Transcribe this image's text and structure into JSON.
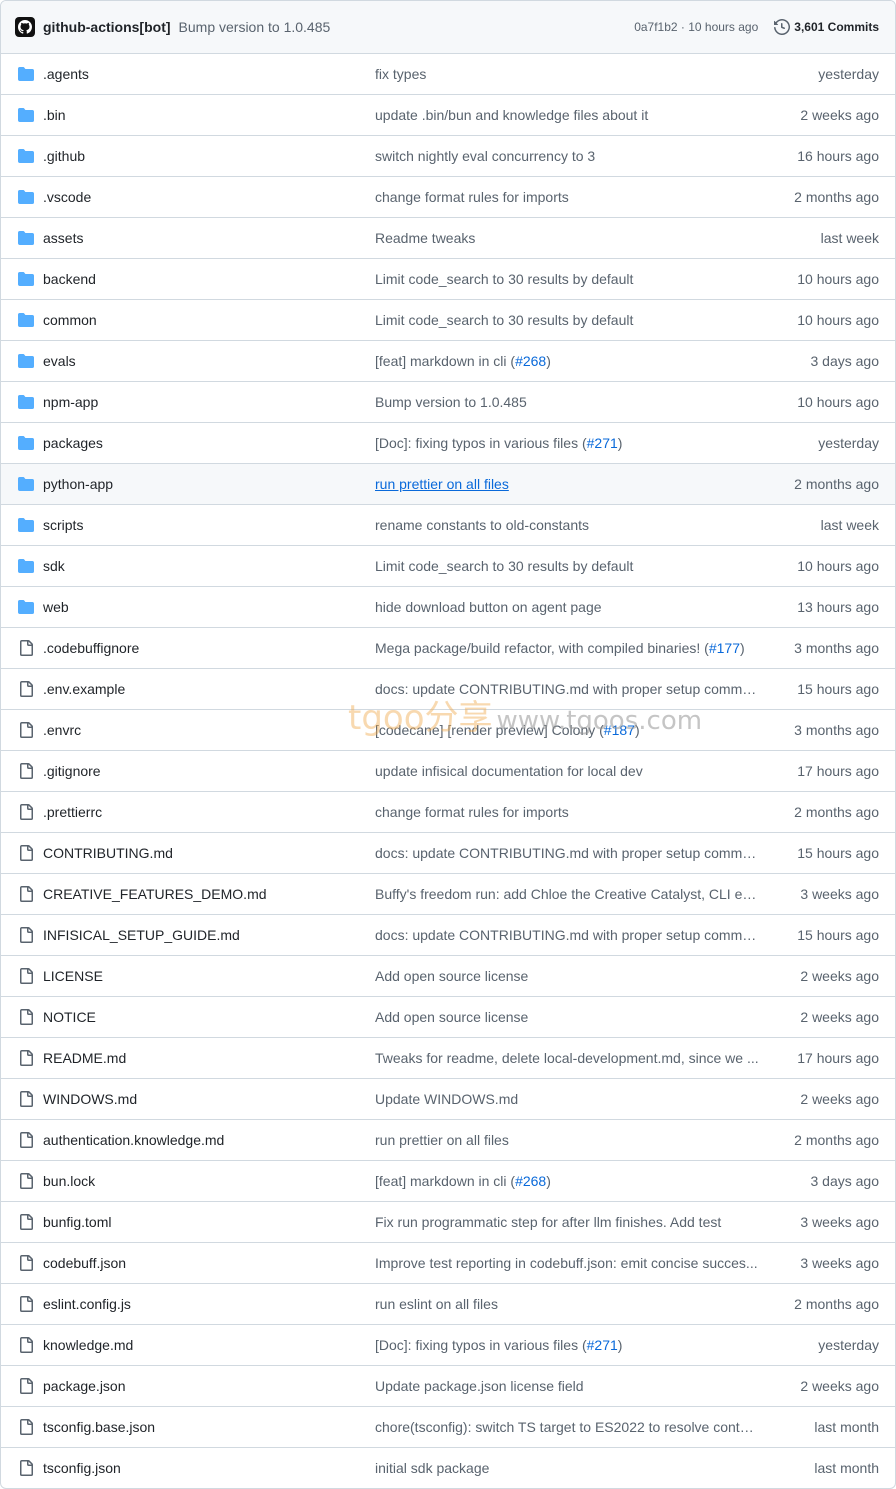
{
  "header": {
    "author": "github-actions[bot]",
    "message": "Bump version to 1.0.485",
    "sha_time": "0a7f1b2 · 10 hours ago",
    "commits": "3,601 Commits"
  },
  "files": [
    {
      "type": "dir",
      "name": ".agents",
      "message": "fix types",
      "time": "yesterday"
    },
    {
      "type": "dir",
      "name": ".bin",
      "message": "update .bin/bun and knowledge files about it",
      "time": "2 weeks ago"
    },
    {
      "type": "dir",
      "name": ".github",
      "message": "switch nightly eval concurrency to 3",
      "time": "16 hours ago"
    },
    {
      "type": "dir",
      "name": ".vscode",
      "message": "change format rules for imports",
      "time": "2 months ago"
    },
    {
      "type": "dir",
      "name": "assets",
      "message": "Readme tweaks",
      "time": "last week"
    },
    {
      "type": "dir",
      "name": "backend",
      "message": "Limit code_search to 30 results by default",
      "time": "10 hours ago"
    },
    {
      "type": "dir",
      "name": "common",
      "message": "Limit code_search to 30 results by default",
      "time": "10 hours ago"
    },
    {
      "type": "dir",
      "name": "evals",
      "message": "[feat] markdown in cli (",
      "pr": "#268",
      "tail": ")",
      "time": "3 days ago"
    },
    {
      "type": "dir",
      "name": "npm-app",
      "message": "Bump version to 1.0.485",
      "time": "10 hours ago"
    },
    {
      "type": "dir",
      "name": "packages",
      "message": "[Doc]: fixing typos in various files (",
      "pr": "#271",
      "tail": ")",
      "time": "yesterday"
    },
    {
      "type": "dir",
      "name": "python-app",
      "message": "run prettier on all files",
      "time": "2 months ago",
      "highlight": true
    },
    {
      "type": "dir",
      "name": "scripts",
      "message": "rename constants to old-constants",
      "time": "last week"
    },
    {
      "type": "dir",
      "name": "sdk",
      "message": "Limit code_search to 30 results by default",
      "time": "10 hours ago"
    },
    {
      "type": "dir",
      "name": "web",
      "message": "hide download button on agent page",
      "time": "13 hours ago"
    },
    {
      "type": "file",
      "name": ".codebuffignore",
      "message": "Mega package/build refactor, with compiled binaries! (",
      "pr": "#177",
      "tail": ")",
      "time": "3 months ago"
    },
    {
      "type": "file",
      "name": ".env.example",
      "message": "docs: update CONTRIBUTING.md with proper setup comma...",
      "time": "15 hours ago"
    },
    {
      "type": "file",
      "name": ".envrc",
      "message": "[codecane] [render preview] Colony (",
      "pr": "#187",
      "tail": ")",
      "time": "3 months ago"
    },
    {
      "type": "file",
      "name": ".gitignore",
      "message": "update infisical documentation for local dev",
      "time": "17 hours ago"
    },
    {
      "type": "file",
      "name": ".prettierrc",
      "message": "change format rules for imports",
      "time": "2 months ago"
    },
    {
      "type": "file",
      "name": "CONTRIBUTING.md",
      "message": "docs: update CONTRIBUTING.md with proper setup comma...",
      "time": "15 hours ago"
    },
    {
      "type": "file",
      "name": "CREATIVE_FEATURES_DEMO.md",
      "message": "Buffy's freedom run: add Chloe the Creative Catalyst, CLI eas...",
      "time": "3 weeks ago"
    },
    {
      "type": "file",
      "name": "INFISICAL_SETUP_GUIDE.md",
      "message": "docs: update CONTRIBUTING.md with proper setup comma...",
      "time": "15 hours ago"
    },
    {
      "type": "file",
      "name": "LICENSE",
      "message": "Add open source license",
      "time": "2 weeks ago"
    },
    {
      "type": "file",
      "name": "NOTICE",
      "message": "Add open source license",
      "time": "2 weeks ago"
    },
    {
      "type": "file",
      "name": "README.md",
      "message": "Tweaks for readme, delete local-development.md, since we ...",
      "time": "17 hours ago"
    },
    {
      "type": "file",
      "name": "WINDOWS.md",
      "message": "Update WINDOWS.md",
      "time": "2 weeks ago"
    },
    {
      "type": "file",
      "name": "authentication.knowledge.md",
      "message": "run prettier on all files",
      "time": "2 months ago"
    },
    {
      "type": "file",
      "name": "bun.lock",
      "message": "[feat] markdown in cli (",
      "pr": "#268",
      "tail": ")",
      "time": "3 days ago"
    },
    {
      "type": "file",
      "name": "bunfig.toml",
      "message": "Fix run programmatic step for after llm finishes. Add test",
      "time": "3 weeks ago"
    },
    {
      "type": "file",
      "name": "codebuff.json",
      "message": "Improve test reporting in codebuff.json: emit concise succes...",
      "time": "3 weeks ago"
    },
    {
      "type": "file",
      "name": "eslint.config.js",
      "message": "run eslint on all files",
      "time": "2 months ago"
    },
    {
      "type": "file",
      "name": "knowledge.md",
      "message": "[Doc]: fixing typos in various files (",
      "pr": "#271",
      "tail": ")",
      "time": "yesterday"
    },
    {
      "type": "file",
      "name": "package.json",
      "message": "Update package.json license field",
      "time": "2 weeks ago"
    },
    {
      "type": "file",
      "name": "tsconfig.base.json",
      "message": "chore(tsconfig): switch TS target to ES2022 to resolve conten...",
      "time": "last month"
    },
    {
      "type": "file",
      "name": "tsconfig.json",
      "message": "initial sdk package",
      "time": "last month"
    }
  ],
  "watermark": {
    "brand": "tgoo分享",
    "url": "www.tgoos.com"
  }
}
